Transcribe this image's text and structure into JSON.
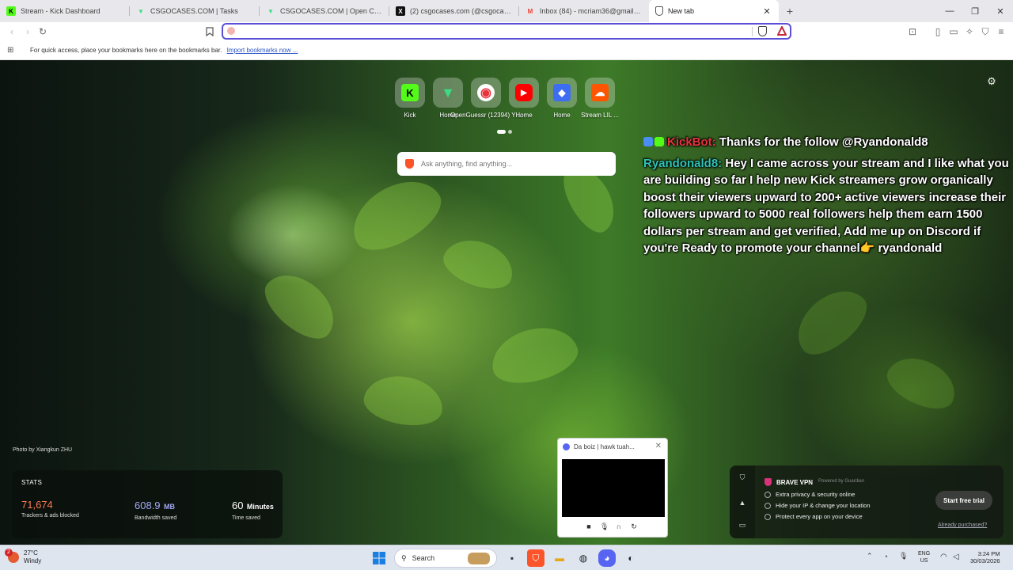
{
  "tabs": [
    {
      "title": "Stream - Kick Dashboard",
      "favicon": "kick-icon",
      "color": "#53fc18"
    },
    {
      "title": "CSGOCASES.COM | Tasks",
      "favicon": "csgocases-icon",
      "color": "#3ddc84"
    },
    {
      "title": "CSGOCASES.COM | Open CS2 Cases",
      "favicon": "csgocases-icon",
      "color": "#3ddc84"
    },
    {
      "title": "(2) csgocases.com (@csgocasescom)",
      "favicon": "x-icon",
      "color": "#111111"
    },
    {
      "title": "Inbox (84) - mcriam36@gmail.com",
      "favicon": "gmail-icon",
      "color": "#ea4335"
    },
    {
      "title": "New tab",
      "favicon": "brave-icon",
      "color": "#555555"
    }
  ],
  "toolbar": {
    "address_value": ""
  },
  "bookmarks_bar": {
    "text": "For quick access, place your bookmarks here on the bookmarks bar.",
    "link": "Import bookmarks now ..."
  },
  "top_sites": [
    {
      "label": "Kick",
      "icon": "kick-icon",
      "color": "#53fc18",
      "glyph": "K"
    },
    {
      "label": "Home",
      "icon": "csgocases-icon",
      "color": "#3ddc84",
      "glyph": ""
    },
    {
      "label": "OpenGuessr (12394) Yo...",
      "icon": "openguessr-icon",
      "color": "#e8323c",
      "glyph": "●"
    },
    {
      "label": "Home",
      "icon": "youtube-icon",
      "color": "#ff0000",
      "glyph": "▶"
    },
    {
      "label": "Home",
      "icon": "roblox-icon",
      "color": "#3d6df2",
      "glyph": "◆"
    },
    {
      "label": "Stream LIL ...",
      "icon": "soundcloud-icon",
      "color": "#ff5500",
      "glyph": "☁"
    }
  ],
  "search": {
    "placeholder": "Ask anything, find anything..."
  },
  "chat": {
    "msg1_user": "KickBot:",
    "msg1_text": " Thanks for the follow @Ryandonald8",
    "msg2_user": "Ryandonald8:",
    "msg2_text": " Hey I came across your stream and I like what you are building so far I help new Kick streamers grow organically boost their viewers upward to 200+ active viewers increase their followers upward to 5000 real followers help them earn 1500 dollars per stream and get verified, Add me up on Discord if you're Ready to promote your channel👉 ryandonald"
  },
  "photo_credit": "Photo by Xiangkun ZHU",
  "stats": {
    "title": "STATS",
    "trackers_value": "71,674",
    "trackers_label": "Trackers & ads blocked",
    "bandwidth_value": "608.9",
    "bandwidth_unit": "MB",
    "bandwidth_label": "Bandwidth saved",
    "time_value": "60",
    "time_unit": "Minutes",
    "time_label": "Time saved"
  },
  "vpn": {
    "title": "BRAVE VPN",
    "powered": "Powered by Guardian",
    "features": [
      "Extra privacy & security online",
      "Hide your IP & change your location",
      "Protect every app on your device"
    ],
    "trial_button": "Start free trial",
    "already_link": "Already purchased?"
  },
  "popout": {
    "title": "Da boiz | hawk tuah..."
  },
  "taskbar": {
    "weather_badge": "2",
    "temp": "27°C",
    "condition": "Windy",
    "search_label": "Search",
    "lang_1": "ENG",
    "lang_2": "US",
    "time": "3:24 PM",
    "date": "30/03/2026"
  }
}
